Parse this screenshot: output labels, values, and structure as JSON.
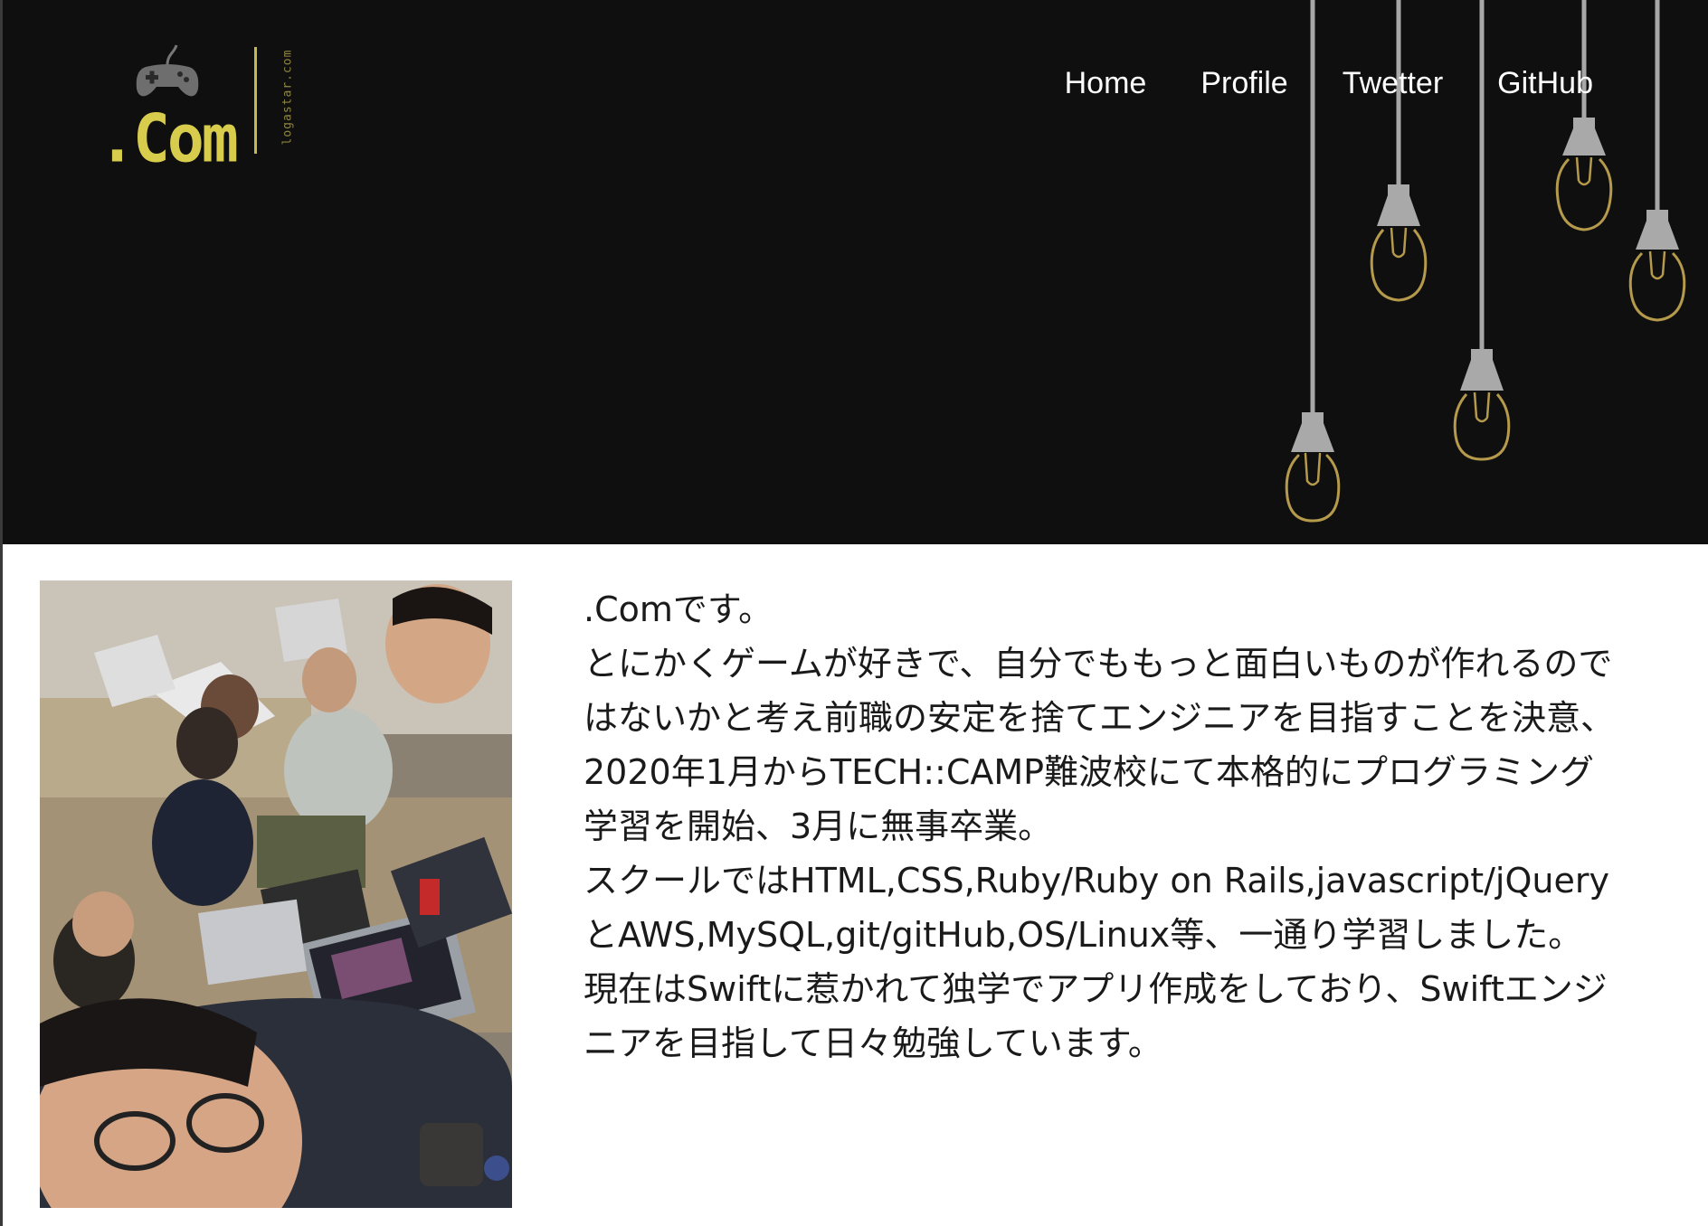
{
  "header": {
    "logo": {
      "text": ".Com",
      "domain": "logastar.com",
      "accent_color": "#d8cc4c",
      "icon": "gamepad-icon"
    },
    "nav": [
      {
        "label": "Home"
      },
      {
        "label": "Profile"
      },
      {
        "label": "Twetter"
      },
      {
        "label": "GitHub"
      }
    ],
    "background_color": "#0f0f0f",
    "decoration": "hanging-light-bulbs"
  },
  "profile": {
    "photo_alt": "group-selfie-photo",
    "bio_lines": [
      ".Comです。",
      "とにかくゲームが好きで、自分でももっと面白いものが作れるので",
      "はないかと考え前職の安定を捨てエンジニアを目指すことを決意、",
      "2020年1月からTECH::CAMP難波校にて本格的にプログラミング",
      "学習を開始、3月に無事卒業。",
      "スクールではHTML,CSS,Ruby/Ruby on Rails,javascript/jQuery",
      "とAWS,MySQL,git/gitHub,OS/Linux等、一通り学習しました。",
      "現在はSwiftに惹かれて独学でアプリ作成をしており、Swiftエンジ",
      "ニアを目指して日々勉強しています。"
    ]
  }
}
